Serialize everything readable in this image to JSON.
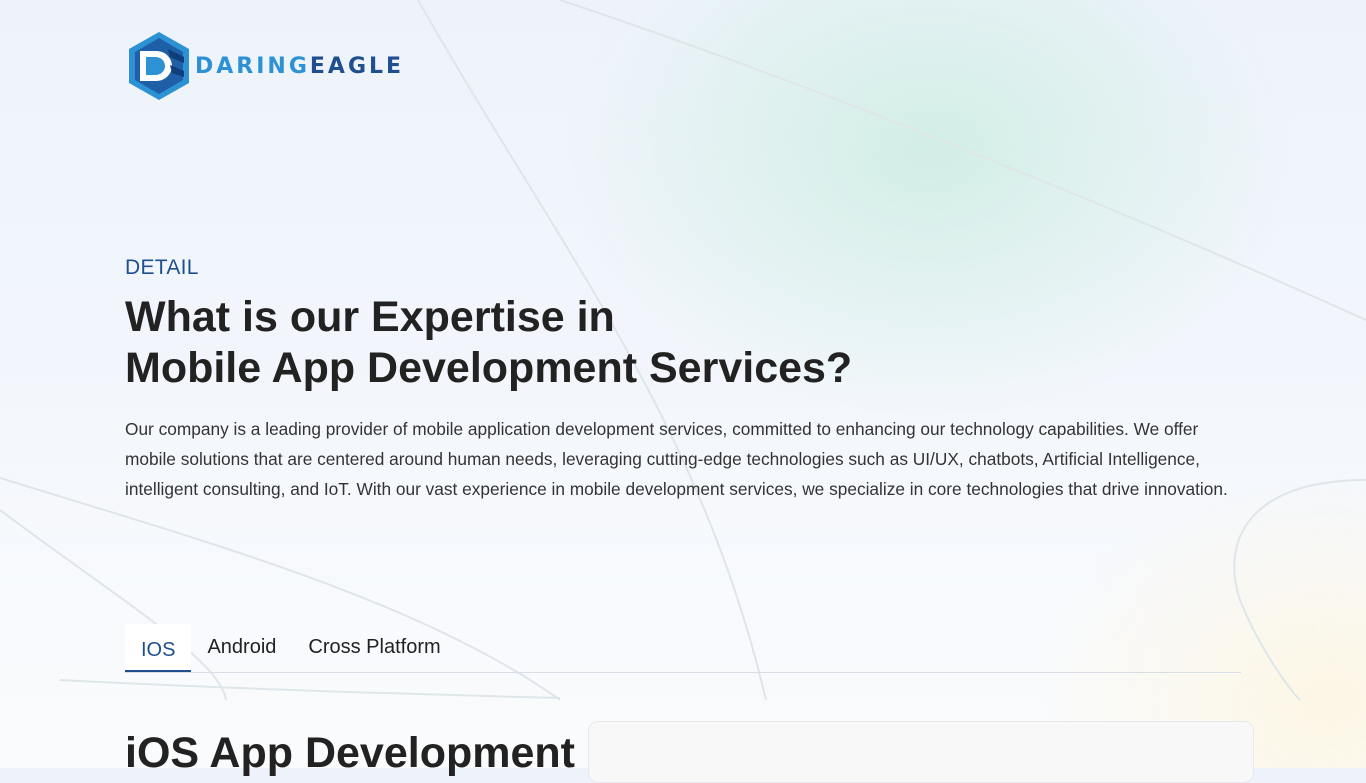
{
  "brand": {
    "name_part1": "DARING",
    "name_part2": "EAGLE"
  },
  "hero": {
    "eyebrow": "DETAIL",
    "title_line1": "What is our Expertise in",
    "title_line2": "Mobile App Development Services?",
    "description": "Our company is a leading provider of mobile application development services, committed to enhancing our technology capabilities. We offer mobile solutions that are centered around human needs, leveraging cutting-edge technologies such as UI/UX, chatbots, Artificial Intelligence, intelligent consulting, and IoT. With our vast experience in mobile development services, we specialize in core technologies that drive innovation."
  },
  "tabs": [
    {
      "label": "IOS",
      "active": true
    },
    {
      "label": "Android",
      "active": false
    },
    {
      "label": "Cross Platform",
      "active": false
    }
  ],
  "section": {
    "title": "iOS App Development"
  },
  "colors": {
    "brand_dark": "#1f4f8f",
    "brand_light": "#2c92d4",
    "text": "#222222"
  }
}
